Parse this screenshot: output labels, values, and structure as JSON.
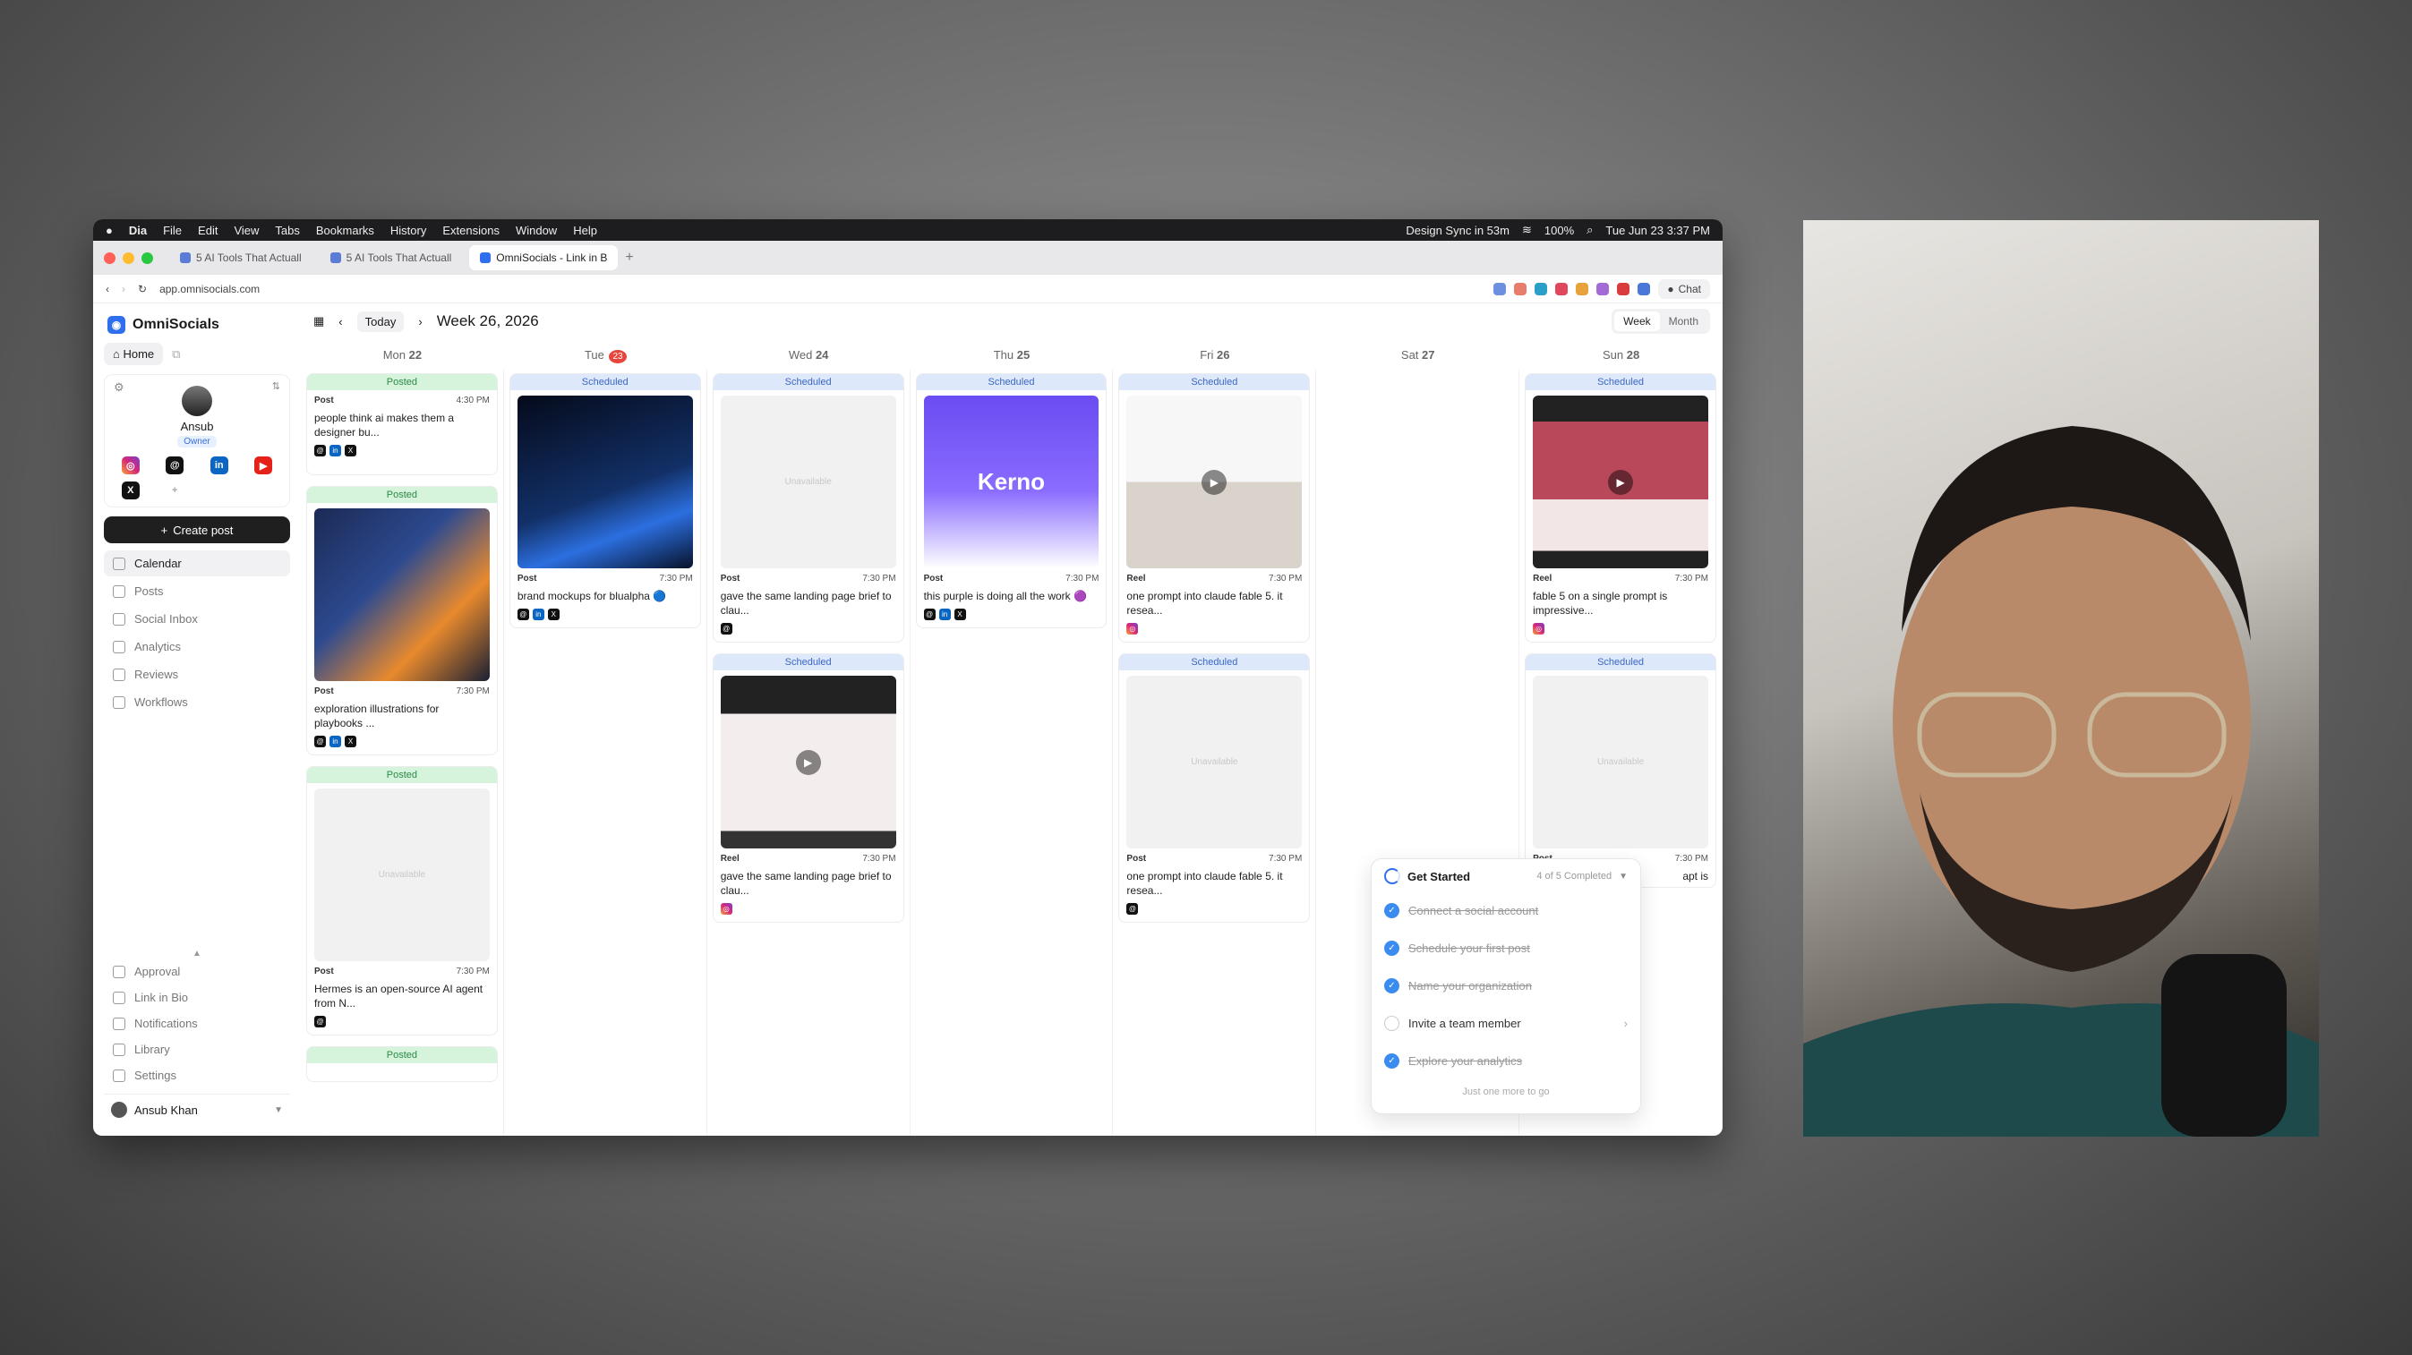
{
  "menubar": {
    "app": "Dia",
    "items": [
      "File",
      "Edit",
      "View",
      "Tabs",
      "Bookmarks",
      "History",
      "Extensions",
      "Window",
      "Help"
    ],
    "status": "Design Sync in 53m",
    "battery": "100%",
    "datetime": "Tue Jun 23  3:37 PM"
  },
  "tabs": [
    {
      "label": "5 AI Tools That Actuall"
    },
    {
      "label": "5 AI Tools That Actuall"
    },
    {
      "label": "OmniSocials - Link in B"
    }
  ],
  "url": "app.omnisocials.com",
  "chat_label": "Chat",
  "sidebar": {
    "brand": "OmniSocials",
    "home": "Home",
    "profile_name": "Ansub",
    "profile_role": "Owner",
    "create": "Create post",
    "nav": [
      {
        "label": "Calendar"
      },
      {
        "label": "Posts"
      },
      {
        "label": "Social Inbox"
      },
      {
        "label": "Analytics"
      },
      {
        "label": "Reviews"
      },
      {
        "label": "Workflows"
      }
    ],
    "bottom": [
      {
        "label": "Approval"
      },
      {
        "label": "Link in Bio"
      },
      {
        "label": "Notifications"
      },
      {
        "label": "Library"
      },
      {
        "label": "Settings"
      }
    ],
    "user": "Ansub Khan"
  },
  "toolbar": {
    "today": "Today",
    "week": "Week 26, 2026",
    "views": [
      "Week",
      "Month"
    ]
  },
  "days": [
    {
      "d": "Mon",
      "n": "22"
    },
    {
      "d": "Tue",
      "n": "23"
    },
    {
      "d": "Wed",
      "n": "24"
    },
    {
      "d": "Thu",
      "n": "25"
    },
    {
      "d": "Fri",
      "n": "26"
    },
    {
      "d": "Sat",
      "n": "27"
    },
    {
      "d": "Sun",
      "n": "28"
    }
  ],
  "posts": {
    "mon": [
      {
        "status": "Posted",
        "type": "Post",
        "time": "4:30 PM",
        "caption": "people think ai makes them a designer bu..."
      },
      {
        "status": "Posted",
        "type": "Post",
        "time": "7:30 PM",
        "caption": "exploration illustrations for playbooks ..."
      },
      {
        "status": "Posted",
        "type": "Post",
        "time": "7:30 PM",
        "caption": "Hermes is an open-source AI agent from N..."
      },
      {
        "status": "Posted"
      }
    ],
    "tue": [
      {
        "status": "Scheduled",
        "type": "Post",
        "time": "7:30 PM",
        "caption": "brand mockups for blualpha 🔵"
      }
    ],
    "wed": [
      {
        "status": "Scheduled",
        "type": "Post",
        "time": "7:30 PM",
        "caption": "gave the same landing page brief to clau..."
      },
      {
        "status": "Scheduled",
        "type": "Reel",
        "time": "7:30 PM",
        "caption": "gave the same landing page brief to clau..."
      }
    ],
    "thu": [
      {
        "status": "Scheduled",
        "type": "Post",
        "time": "7:30 PM",
        "caption": "this purple is doing all the work 🟣",
        "thumb_text": "Kerno"
      }
    ],
    "fri": [
      {
        "status": "Scheduled",
        "type": "Reel",
        "time": "7:30 PM",
        "caption": "one prompt into claude fable 5. it resea..."
      },
      {
        "status": "Scheduled",
        "type": "Post",
        "time": "7:30 PM",
        "caption": "one prompt into claude fable 5. it resea..."
      }
    ],
    "sun": [
      {
        "status": "Scheduled",
        "type": "Reel",
        "time": "7:30 PM",
        "caption": "fable 5 on a single prompt is impressive..."
      },
      {
        "status": "Scheduled",
        "type": "Post",
        "time": "7:30 PM",
        "caption": "apt is"
      }
    ]
  },
  "unavailable": "Unavailable",
  "get_started": {
    "title": "Get Started",
    "progress": "4 of 5 Completed",
    "tasks": [
      {
        "label": "Connect a social account"
      },
      {
        "label": "Schedule your first post"
      },
      {
        "label": "Name your organization"
      },
      {
        "label": "Invite a team member"
      },
      {
        "label": "Explore your analytics"
      }
    ],
    "footer": "Just one more to go"
  }
}
